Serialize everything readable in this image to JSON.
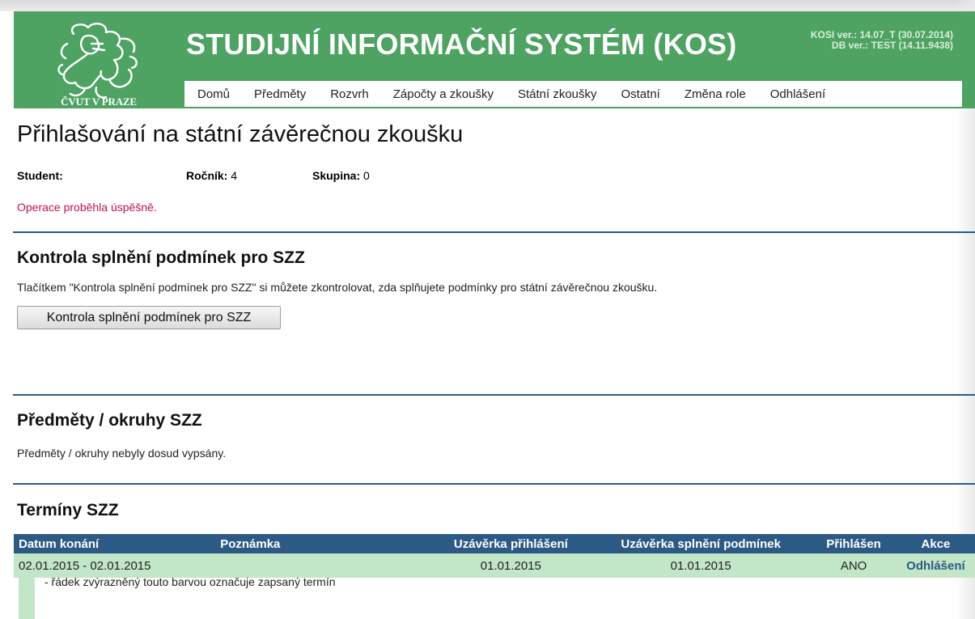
{
  "header": {
    "logo_text": "ČVUT V PRAZE",
    "title": "STUDIJNÍ INFORMAČNÍ SYSTÉM (KOS)",
    "version_line1": "KOSI ver.: 14.07_T (30.07.2014)",
    "version_line2": "DB ver.: TEST (14.11.9438)",
    "header_color": "#4ea363"
  },
  "nav": {
    "items": [
      "Domů",
      "Předměty",
      "Rozvrh",
      "Zápočty a zkoušky",
      "Státní zkoušky",
      "Ostatní",
      "Změna role",
      "Odhlášení"
    ]
  },
  "page": {
    "title": "Přihlašování na státní závěrečnou zkoušku",
    "student_label": "Student:",
    "rocnik_label": "Ročník:",
    "rocnik_value": "4",
    "skupina_label": "Skupina:",
    "skupina_value": "0",
    "success_message": "Operace proběhla úspěšně.",
    "success_color": "#c0134c"
  },
  "check_section": {
    "title": "Kontrola splnění podmínek pro SZZ",
    "description": "Tlačítkem \"Kontrola splnění podmínek pro SZZ\" si můžete zkontrolovat, zda splňujete podmínky pro státní závěrečnou zkoušku.",
    "button_label": "Kontrola splnění podmínek pro SZZ"
  },
  "subjects_section": {
    "title": "Předměty / okruhy SZZ",
    "message": "Předměty / okruhy nebyly dosud vypsány."
  },
  "terms_section": {
    "title": "Termíny SZZ",
    "columns": {
      "datum": "Datum konání",
      "poznamka": "Poznámka",
      "uzaverka_prihlaseni": "Uzávěrka přihlášení",
      "uzaverka_podminek": "Uzávěrka splnění podmínek",
      "prihlasen": "Přihlášen",
      "akce": "Akce"
    },
    "rows": [
      {
        "datum": "02.01.2015 - 02.01.2015",
        "poznamka": "",
        "uzaverka_prihlaseni": "01.01.2015",
        "uzaverka_podminek": "01.01.2015",
        "prihlasen": "ANO",
        "akce": "Odhlášení"
      }
    ],
    "legend_text": "- řádek zvýrazněný touto barvou označuje zapsaný termín",
    "highlight_color": "#c2e6c8",
    "header_color": "#2c5a85"
  }
}
